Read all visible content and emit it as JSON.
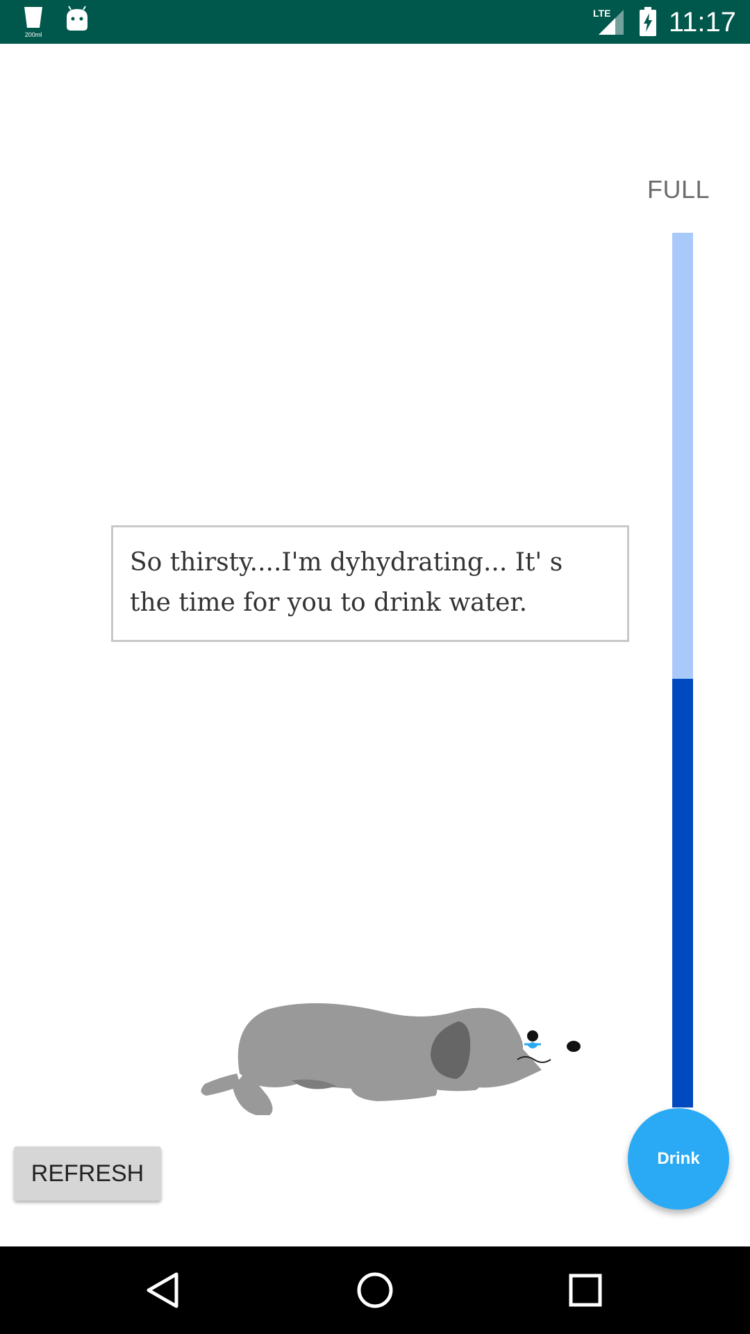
{
  "status_bar": {
    "time": "11:17",
    "network": "LTE",
    "app_icon": "cup-icon",
    "app_icon_caption": "200ml",
    "second_icon": "android-icon",
    "color": "#00574b"
  },
  "gauge": {
    "full_label": "FULL",
    "level_percent": 49,
    "track_color": "#aac9fb",
    "fill_color": "#0049bf"
  },
  "speech_bubble": {
    "text": "So thirsty....I'm dyhydrating... It' s the time for you to drink water."
  },
  "mascot": {
    "icon": "sad-dog-icon"
  },
  "buttons": {
    "refresh_label": "REFRESH",
    "drink_label": "Drink",
    "fab_color": "#2aaaf4"
  },
  "nav_bar": {
    "icons": [
      "back-icon",
      "home-icon",
      "recents-icon"
    ]
  }
}
